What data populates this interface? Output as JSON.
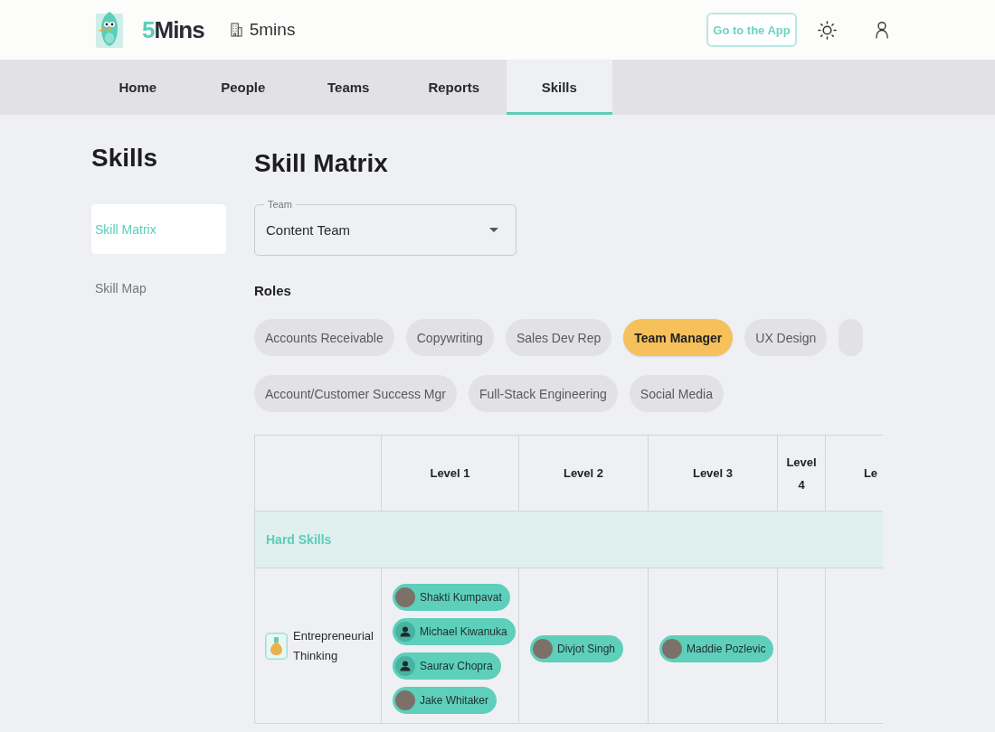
{
  "header": {
    "brand": "5Mins",
    "workspace": "5mins",
    "app_button": "Go to the App"
  },
  "tabs": [
    {
      "label": "Home",
      "selected": false
    },
    {
      "label": "People",
      "selected": false
    },
    {
      "label": "Teams",
      "selected": false
    },
    {
      "label": "Reports",
      "selected": false
    },
    {
      "label": "Skills",
      "selected": true
    }
  ],
  "sidebar": {
    "title": "Skills",
    "items": [
      {
        "label": "Skill Matrix",
        "selected": true
      },
      {
        "label": "Skill Map",
        "selected": false
      }
    ]
  },
  "main": {
    "title": "Skill Matrix",
    "team_select": {
      "label": "Team",
      "value": "Content Team"
    },
    "roles": {
      "title": "Roles",
      "rows": [
        {
          "chips": [
            {
              "label": "Accounts Receivable",
              "selected": false
            },
            {
              "label": "Copywriting",
              "selected": false
            },
            {
              "label": "Sales Dev Rep",
              "selected": false
            },
            {
              "label": "Team Manager",
              "selected": true
            },
            {
              "label": "UX Design",
              "selected": false
            },
            {
              "selected": false
            }
          ]
        },
        {
          "chips": [
            {
              "label": "Account/Customer Success Mgr",
              "selected": false
            },
            {
              "label": "Full-Stack Engineering",
              "selected": false
            },
            {
              "label": "Social Media",
              "selected": false
            }
          ]
        }
      ]
    },
    "matrix": {
      "columns": [
        "Level 1",
        "Level 2",
        "Level 3",
        "Level 4",
        "Le"
      ],
      "groups": [
        {
          "title": "Hard Skills",
          "skills": [
            {
              "name": "Entrepreneurial Thinking",
              "cells": [
                {
                  "people": [
                    {
                      "name": "Shakti Kumpavat",
                      "kind": "photo"
                    },
                    {
                      "name": "Michael Kiwanuka",
                      "kind": "default"
                    },
                    {
                      "name": "Saurav Chopra",
                      "kind": "default"
                    },
                    {
                      "name": "Jake Whitaker",
                      "kind": "photo"
                    }
                  ]
                },
                {
                  "people": [
                    {
                      "name": "Divjot Singh",
                      "kind": "photo"
                    }
                  ]
                },
                {
                  "people": [
                    {
                      "name": "Maddie Pozlevic",
                      "kind": "photo"
                    }
                  ]
                }
              ]
            }
          ]
        }
      ]
    }
  }
}
